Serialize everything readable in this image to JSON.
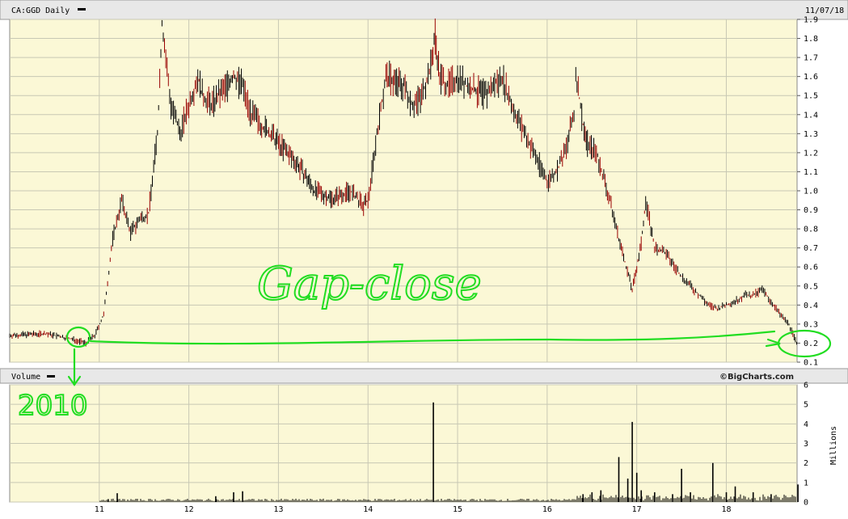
{
  "header": {
    "symbol": "CA:GGD Daily",
    "date": "11/07/18"
  },
  "volume_panel": {
    "label": "Volume",
    "brand": "©BigCharts.com",
    "unit": "Millions"
  },
  "annotations": {
    "gap_text": "Gap-close",
    "year_text": "2010",
    "color": "#22dd22"
  },
  "colors": {
    "background": "#fbf8d6",
    "grid": "#c8c8b4",
    "bar_up": "#000000",
    "bar_down": "#990000"
  },
  "chart_data": [
    {
      "type": "line",
      "title": "CA:GGD Daily",
      "scale": "linear",
      "ylim": [
        0.1,
        1.9
      ],
      "yticks": [
        "0.1",
        "0.2",
        "0.3",
        "0.4",
        "0.5",
        "0.6",
        "0.7",
        "0.8",
        "0.9",
        "1.0",
        "1.1",
        "1.2",
        "1.3",
        "1.4",
        "1.5",
        "1.6",
        "1.7",
        "1.8",
        "1.9"
      ],
      "xticks": [
        "11",
        "12",
        "13",
        "14",
        "15",
        "16",
        "17",
        "18"
      ],
      "x": [
        10.0,
        10.4,
        10.7,
        10.85,
        10.95,
        11.05,
        11.15,
        11.25,
        11.35,
        11.45,
        11.55,
        11.65,
        11.7,
        11.8,
        11.9,
        12.0,
        12.1,
        12.15,
        12.25,
        12.5,
        12.6,
        12.7,
        12.8,
        13.0,
        13.2,
        13.4,
        13.6,
        13.8,
        13.95,
        14.0,
        14.1,
        14.2,
        14.4,
        14.5,
        14.6,
        14.7,
        14.75,
        14.8,
        14.9,
        15.0,
        15.1,
        15.3,
        15.4,
        15.5,
        15.6,
        15.7,
        15.8,
        15.9,
        16.0,
        16.1,
        16.2,
        16.3,
        16.32,
        16.4,
        16.45,
        16.55,
        16.7,
        16.8,
        16.95,
        17.0,
        17.05,
        17.1,
        17.2,
        17.3,
        17.4,
        17.5,
        17.6,
        17.7,
        17.8,
        17.9,
        18.0,
        18.1,
        18.2,
        18.3,
        18.4,
        18.5,
        18.6,
        18.7,
        18.8
      ],
      "y": [
        0.24,
        0.25,
        0.22,
        0.2,
        0.24,
        0.35,
        0.75,
        0.95,
        0.78,
        0.85,
        0.88,
        1.3,
        1.88,
        1.45,
        1.3,
        1.45,
        1.6,
        1.5,
        1.45,
        1.6,
        1.55,
        1.4,
        1.35,
        1.25,
        1.15,
        1.0,
        0.96,
        1.0,
        0.92,
        0.95,
        1.3,
        1.6,
        1.55,
        1.45,
        1.5,
        1.65,
        1.82,
        1.6,
        1.55,
        1.6,
        1.55,
        1.5,
        1.55,
        1.6,
        1.45,
        1.35,
        1.25,
        1.15,
        1.05,
        1.1,
        1.2,
        1.4,
        1.62,
        1.35,
        1.25,
        1.2,
        0.95,
        0.75,
        0.48,
        0.6,
        0.72,
        0.95,
        0.7,
        0.68,
        0.62,
        0.55,
        0.5,
        0.45,
        0.4,
        0.38,
        0.4,
        0.42,
        0.45,
        0.45,
        0.48,
        0.42,
        0.35,
        0.3,
        0.18
      ]
    },
    {
      "type": "bar",
      "title": "Volume",
      "ylabel": "Millions",
      "ylim": [
        0,
        6
      ],
      "yticks": [
        "0",
        "1",
        "2",
        "3",
        "4",
        "5",
        "6"
      ],
      "x": [
        11.1,
        11.2,
        12.3,
        12.5,
        12.6,
        14.73,
        16.4,
        16.5,
        16.6,
        16.8,
        16.9,
        16.95,
        17.0,
        17.05,
        17.2,
        17.4,
        17.5,
        17.6,
        17.85,
        18.0,
        18.1,
        18.3,
        18.5,
        18.8
      ],
      "values": [
        0.15,
        0.45,
        0.3,
        0.5,
        0.55,
        5.1,
        0.4,
        0.5,
        0.6,
        2.3,
        1.2,
        4.1,
        1.5,
        0.6,
        0.5,
        0.4,
        1.7,
        0.5,
        2.0,
        0.5,
        0.8,
        0.5,
        0.4,
        0.9
      ]
    }
  ]
}
